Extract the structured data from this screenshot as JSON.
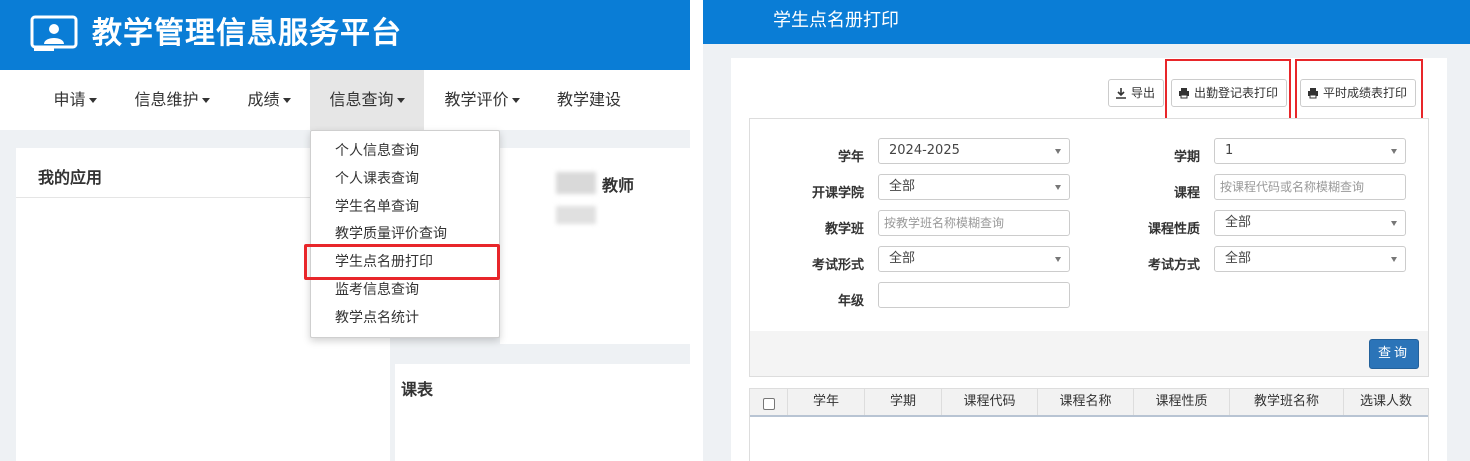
{
  "left": {
    "site_title": "教学管理信息服务平台",
    "nav": [
      {
        "label": "申请"
      },
      {
        "label": "信息维护"
      },
      {
        "label": "成绩"
      },
      {
        "label": "信息查询"
      },
      {
        "label": "教学评价"
      },
      {
        "label": "教学建设"
      }
    ],
    "dropdown": [
      "个人信息查询",
      "个人课表查询",
      "学生名单查询",
      "教学质量评价查询",
      "学生点名册打印",
      "监考信息查询",
      "教学点名统计"
    ],
    "my_apps_title": "我的应用",
    "teacher_role": "教师",
    "schedule_title": "课表"
  },
  "right": {
    "page_title": "学生点名册打印",
    "toolbar": {
      "export": "导出",
      "attendance_print": "出勤登记表打印",
      "grade_print": "平时成绩表打印"
    },
    "form": {
      "year_label": "学年",
      "year_value": "2024-2025",
      "term_label": "学期",
      "term_value": "1",
      "college_label": "开课学院",
      "college_value": "全部",
      "course_label": "课程",
      "course_placeholder": "按课程代码或名称模糊查询",
      "class_label": "教学班",
      "class_placeholder": "按教学班名称模糊查询",
      "nature_label": "课程性质",
      "nature_value": "全部",
      "exam_form_label": "考试形式",
      "exam_form_value": "全部",
      "exam_method_label": "考试方式",
      "exam_method_value": "全部",
      "grade_label": "年级",
      "grade_value": ""
    },
    "query_button": "查询",
    "table_headers": [
      "学年",
      "学期",
      "课程代码",
      "课程名称",
      "课程性质",
      "教学班名称",
      "选课人数"
    ]
  },
  "colors": {
    "header_blue": "#0a7dd6",
    "highlight_red": "#e8262a",
    "query_button": "#2b74b8"
  }
}
